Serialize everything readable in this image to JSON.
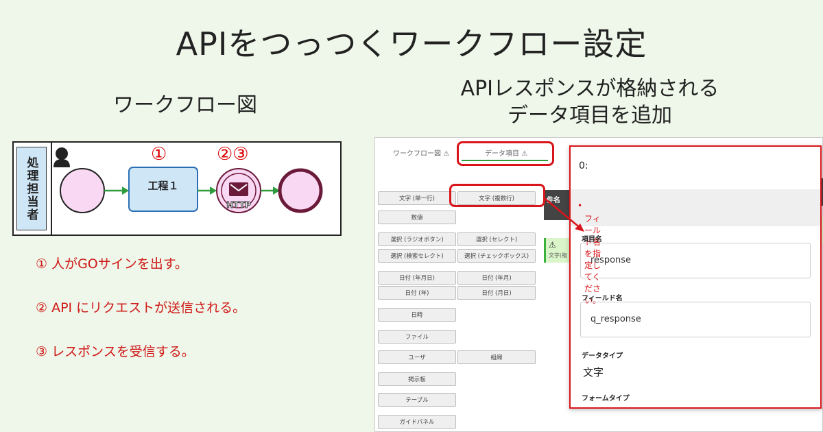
{
  "title": "APIをつっつくワークフロー設定",
  "workflow": {
    "heading": "ワークフロー図",
    "swimlane": "処理担当者",
    "task_label": "工程１",
    "event_label": "HTTP",
    "step_1": "①",
    "step_23": "②③",
    "notes": [
      "① 人がGOサインを出す。",
      "② API にリクエストが送信される。",
      "③ レスポンスを受信する。"
    ]
  },
  "right": {
    "heading_line1": "APIレスポンスが格納される",
    "heading_line2": "データ項目を追加"
  },
  "screenshot": {
    "tabs": [
      "ワークフロー図",
      "データ項目"
    ],
    "field_types": {
      "text_single": "文字 (単一行)",
      "text_multi": "文字 (複数行)",
      "number": "数値",
      "select_radio": "選択 (ラジオボタン)",
      "select_select": "選択 (セレクト)",
      "select_search": "選択 (検索セレクト)",
      "select_check": "選択 (チェックボックス)",
      "date_ymd": "日付 (年月日)",
      "date_ym": "日付 (年月)",
      "date_y": "日付 (年)",
      "date_md": "日付 (月日)",
      "datetime": "日時",
      "file": "ファイル",
      "user": "ユーザ",
      "org": "組織",
      "board": "掲示板",
      "table": "テーブル",
      "guide": "ガイドパネル"
    },
    "table_header": "件名",
    "table_cell": "文字(複",
    "warning_icon": "warning-triangle-icon",
    "panel": {
      "index": "0:",
      "error": "フィールド名を指定してください。",
      "item_name_label": "項目名",
      "item_name_value": "response",
      "field_name_label": "フィールド名",
      "field_name_value": "q_response",
      "data_type_label": "データタイプ",
      "data_type_value": "文字",
      "form_type_label": "フォームタイプ"
    }
  },
  "colors": {
    "background": "#eef7e9",
    "accent_red": "#d9141a",
    "task_blue": "#cfe6f7",
    "event_pink": "#f9d8f4",
    "flow_green": "#2d9b3e"
  }
}
